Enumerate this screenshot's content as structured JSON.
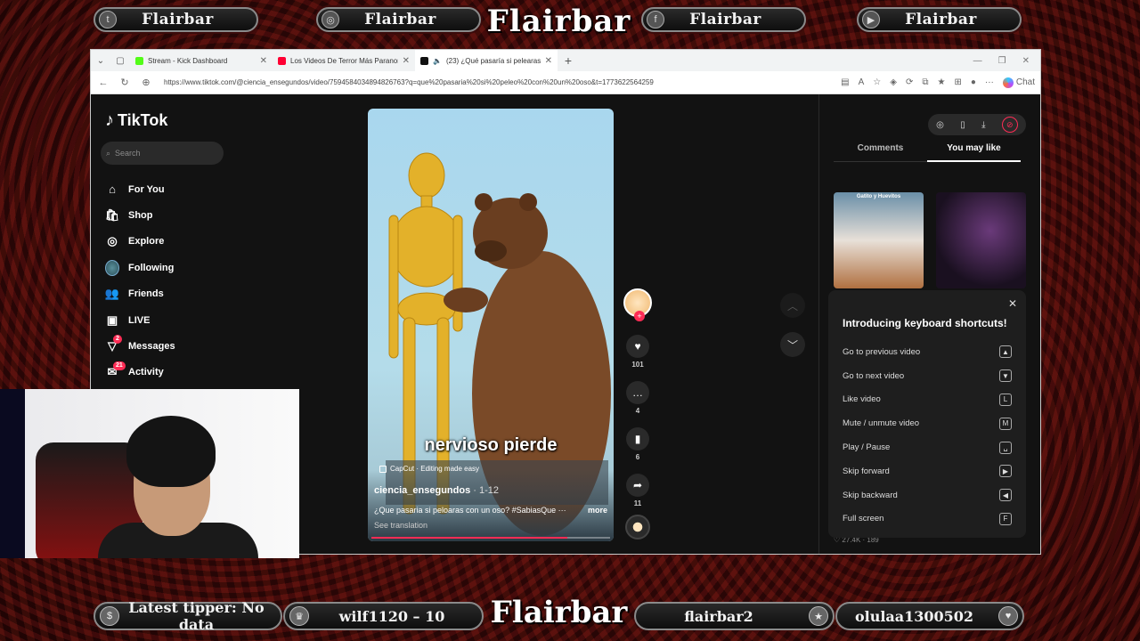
{
  "overlay": {
    "brand": "Flairbar",
    "social": [
      {
        "icon": "twitter-icon",
        "glyph": "t",
        "label": "Flairbar"
      },
      {
        "icon": "instagram-icon",
        "glyph": "◎",
        "label": "Flairbar"
      },
      {
        "icon": "facebook-icon",
        "glyph": "f",
        "label": "Flairbar"
      },
      {
        "icon": "youtube-icon",
        "glyph": "▶",
        "label": "Flairbar"
      }
    ],
    "bottom": {
      "latest_tipper": "Latest tipper: No data",
      "stat1": "wilf1120 – 10",
      "stat2": "flairbar2",
      "stat3": "olulaa1300502"
    }
  },
  "browser": {
    "tabs": [
      {
        "title": "Stream - Kick Dashboard",
        "color": "#53fc18"
      },
      {
        "title": "Los Videos De Terror Más Paranor",
        "color": "#ff0033"
      },
      {
        "title": "(23) ¿Qué pasaría si pelearas c",
        "color": "#111111"
      }
    ],
    "url": "https://www.tiktok.com/@ciencia_ensegundos/video/7594584034894826763?q=que%20pasaria%20si%20peleo%20con%20un%20oso&t=1773622564259",
    "chat_label": "Chat"
  },
  "tiktok": {
    "logo": "TikTok",
    "search_placeholder": "Search",
    "nav": [
      {
        "label": "For You",
        "icon": "home-icon",
        "glyph": "⌂"
      },
      {
        "label": "Shop",
        "icon": "shop-icon",
        "glyph": "🛍"
      },
      {
        "label": "Explore",
        "icon": "compass-icon",
        "glyph": "◎"
      },
      {
        "label": "Following",
        "icon": "following-avatar",
        "glyph": ""
      },
      {
        "label": "Friends",
        "icon": "friends-icon",
        "glyph": "👥"
      },
      {
        "label": "LIVE",
        "icon": "live-icon",
        "glyph": "▣"
      },
      {
        "label": "Messages",
        "icon": "messages-icon",
        "glyph": "▽",
        "badge": "2"
      },
      {
        "label": "Activity",
        "icon": "activity-icon",
        "glyph": "✉",
        "badge": "21"
      }
    ],
    "video": {
      "caption_overlay": "nervioso pierde",
      "capcut": "CapCut · Editing made easy",
      "author": "ciencia_ensegundos",
      "date": " · 1-12",
      "description": "¿Que pasaria si peloaras con un oso? #SabiasQue ···",
      "more": "more",
      "see_translation": "See translation",
      "progress": 0.82
    },
    "actions": {
      "likes": "101",
      "comments": "4",
      "saves": "6",
      "shares": "11"
    },
    "panel": {
      "tab_comments": "Comments",
      "tab_you_may_like": "You may like",
      "thumb1_label": "Gatito y Huevitos",
      "shortcuts_title": "Introducing keyboard shortcuts!",
      "shortcuts": [
        {
          "label": "Go to previous video",
          "key": "▲"
        },
        {
          "label": "Go to next video",
          "key": "▼"
        },
        {
          "label": "Like video",
          "key": "L"
        },
        {
          "label": "Mute / unmute video",
          "key": "M"
        },
        {
          "label": "Play / Pause",
          "key": "␣"
        },
        {
          "label": "Skip forward",
          "key": "▶"
        },
        {
          "label": "Skip backward",
          "key": "◀"
        },
        {
          "label": "Full screen",
          "key": "F"
        }
      ],
      "hidden_stats": "♡ 27.4K · 189"
    }
  }
}
